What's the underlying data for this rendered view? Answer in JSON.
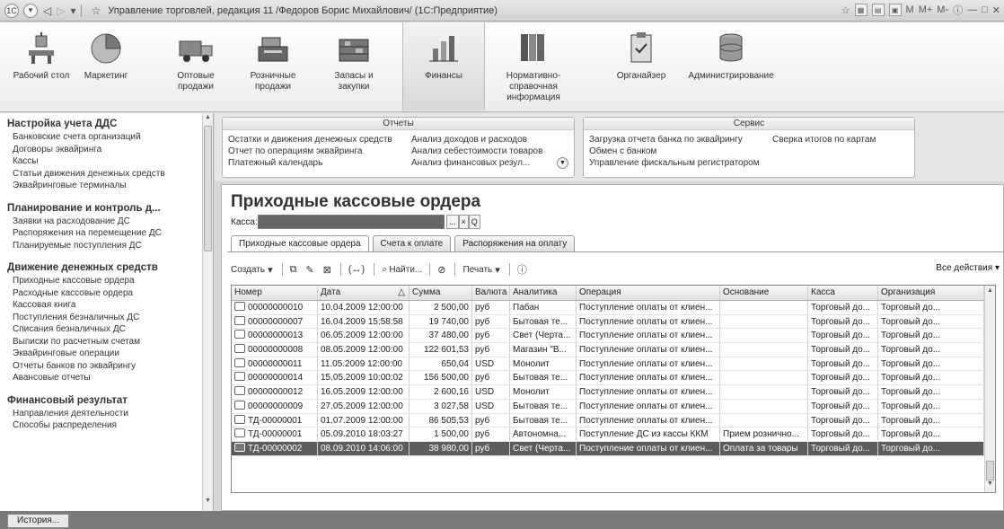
{
  "window": {
    "title": "Управление торговлей, редакция 11 /Федоров Борис Михайлович/ (1С:Предприятие)",
    "right_tools": [
      "M",
      "M+",
      "M-"
    ]
  },
  "sections": [
    {
      "label": "Рабочий стол",
      "icon": "desk-icon"
    },
    {
      "label": "Маркетинг",
      "icon": "pie-chart-icon"
    },
    {
      "label": "Оптовые продажи",
      "icon": "truck-icon"
    },
    {
      "label": "Розничные продажи",
      "icon": "cash-register-icon"
    },
    {
      "label": "Запасы и закупки",
      "icon": "warehouse-icon"
    },
    {
      "label": "Финансы",
      "icon": "finance-chart-icon",
      "active": true
    },
    {
      "label": "Нормативно-справочная информация",
      "icon": "binders-icon"
    },
    {
      "label": "Органайзер",
      "icon": "clipboard-icon"
    },
    {
      "label": "Администрирование",
      "icon": "database-icon"
    }
  ],
  "nav": {
    "groups": [
      {
        "title": "Настройка учета ДДС",
        "items": [
          "Банковские счета организаций",
          "Договоры эквайринга",
          "Кассы",
          "Статьи движения денежных средств",
          "Эквайринговые терминалы"
        ]
      },
      {
        "title": "Планирование и контроль д...",
        "items": [
          "Заявки на расходование ДС",
          "Распоряжения на перемещение ДС",
          "Планируемые поступления ДС"
        ]
      },
      {
        "title": "Движение денежных средств",
        "items": [
          "Приходные кассовые ордера",
          "Расходные кассовые ордера",
          "Кассовая книга",
          "Поступления безналичных ДС",
          "Списания безналичных ДС",
          "Выписки по расчетным счетам",
          "Эквайринговые операции",
          "Отчеты банков по эквайрингу",
          "Авансовые отчеты"
        ]
      },
      {
        "title": "Финансовый результат",
        "items": [
          "Направления деятельности",
          "Способы распределения"
        ]
      }
    ]
  },
  "reports_panel": {
    "caption": "Отчеты",
    "col1": [
      "Остатки и движения денежных средств",
      "Отчет по операциям эквайринга",
      "Платежный календарь"
    ],
    "col2": [
      "Анализ доходов и расходов",
      "Анализ себестоимости товаров",
      "Анализ финансовых резул..."
    ]
  },
  "service_panel": {
    "caption": "Сервис",
    "col1": [
      "Загрузка отчета банка по эквайрингу",
      "Обмен с банком",
      "Управление фискальным регистратором"
    ],
    "col2": [
      "Сверка итогов по картам"
    ]
  },
  "form": {
    "title": "Приходные кассовые ордера",
    "kassa_label": "Касса:",
    "kassa_buttons": [
      "...",
      "×",
      "Q"
    ],
    "tabs": [
      "Приходные кассовые ордера",
      "Счета к оплате",
      "Распоряжения на оплату"
    ],
    "toolbar": {
      "create": "Создать",
      "find": "Найти...",
      "print": "Печать",
      "all_actions": "Все действия"
    }
  },
  "table": {
    "columns": [
      "Номер",
      "Дата",
      "Сумма",
      "Валюта",
      "Аналитика",
      "Операция",
      "Основание",
      "Касса",
      "Организация"
    ],
    "rows": [
      [
        "00000000010",
        "10.04.2009 12:00:00",
        "2 500,00",
        "руб",
        "Пабан",
        "Поступление оплаты от клиен...",
        "",
        "Торговый до...",
        "Торговый до..."
      ],
      [
        "00000000007",
        "16.04.2009 15:58:58",
        "19 740,00",
        "руб",
        "Бытовая те...",
        "Поступление оплаты от клиен...",
        "",
        "Торговый до...",
        "Торговый до..."
      ],
      [
        "00000000013",
        "06.05.2009 12:00:00",
        "37 480,00",
        "руб",
        "Свет (Черта...",
        "Поступление оплаты от клиен...",
        "",
        "Торговый до...",
        "Торговый до..."
      ],
      [
        "00000000008",
        "08.05.2009 12:00:00",
        "122 601,53",
        "руб",
        "Магазин \"В...",
        "Поступление оплаты от клиен...",
        "",
        "Торговый до...",
        "Торговый до..."
      ],
      [
        "00000000011",
        "11.05.2009 12:00:00",
        "650,04",
        "USD",
        "Монолит",
        "Поступление оплаты от клиен...",
        "",
        "Торговый до...",
        "Торговый до..."
      ],
      [
        "00000000014",
        "15.05.2009 10:00:02",
        "156 500,00",
        "руб",
        "Бытовая те...",
        "Поступление оплаты от клиен...",
        "",
        "Торговый до...",
        "Торговый до..."
      ],
      [
        "00000000012",
        "16.05.2009 12:00:00",
        "2 600,16",
        "USD",
        "Монолит",
        "Поступление оплаты от клиен...",
        "",
        "Торговый до...",
        "Торговый до..."
      ],
      [
        "00000000009",
        "27.05.2009 12:00:00",
        "3 027,58",
        "USD",
        "Бытовая те...",
        "Поступление оплаты от клиен...",
        "",
        "Торговый до...",
        "Торговый до..."
      ],
      [
        "ТД-00000001",
        "01.07.2009 12:00:00",
        "86 505,53",
        "руб",
        "Бытовая те...",
        "Поступление оплаты от клиен...",
        "",
        "Торговый до...",
        "Торговый до..."
      ],
      [
        "ТД-00000001",
        "05.09.2010 18:03:27",
        "1 500,00",
        "руб",
        "Автономна...",
        "Поступление ДС из кассы ККМ",
        "Прием рознично...",
        "Торговый до...",
        "Торговый до..."
      ],
      [
        "ТД-00000002",
        "08.09.2010 14:06:00",
        "38 980,00",
        "руб",
        "Свет (Черта...",
        "Поступление оплаты от клиен...",
        "Оплата за товары",
        "Торговый до...",
        "Торговый до..."
      ]
    ],
    "selected_row": 10
  },
  "bottom": {
    "history_button": "История..."
  }
}
